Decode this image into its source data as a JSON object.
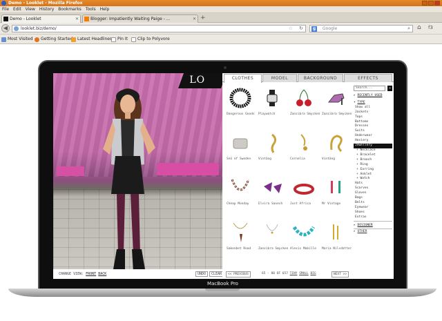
{
  "window": {
    "title": "Demo - Looklet - Mozilla Firefox"
  },
  "menu": [
    "File",
    "Edit",
    "View",
    "History",
    "Bookmarks",
    "Tools",
    "Help"
  ],
  "tabs": [
    {
      "label": "Demo - Looklet",
      "active": true
    },
    {
      "label": "Blogger: Impatiently Waiting Paige - ...",
      "active": false
    }
  ],
  "nav": {
    "url": "looklet.biz/demo/",
    "search_placeholder": "Google"
  },
  "bookmarks": [
    "Most Visited",
    "Getting Started",
    "Latest Headlines",
    "Pin It",
    "Clip to Polyvore"
  ],
  "app": {
    "logo": "LO",
    "panel_tabs": [
      "CLOTHES",
      "MODEL",
      "BACKGROUND",
      "EFFECTS"
    ],
    "items": [
      {
        "label": "Dangerous Goods",
        "icon": "black-beaded-necklace"
      },
      {
        "label": "Playwatch",
        "icon": "watch"
      },
      {
        "label": "Zanzibra Smycken",
        "icon": "cherry-earrings"
      },
      {
        "label": "Zanzibra Smycken",
        "icon": "shoe-brooch"
      },
      {
        "label": "Snö of Sweden",
        "icon": "silver-cuff"
      },
      {
        "label": "Vintäng",
        "icon": "gold-ring"
      },
      {
        "label": "Cornelia",
        "icon": "gold-pendant"
      },
      {
        "label": "Vintäng",
        "icon": "gold-brooch"
      },
      {
        "label": "Cheap Monday",
        "icon": "tribal-necklace"
      },
      {
        "label": "Elvira Saxesh",
        "icon": "purple-earrings"
      },
      {
        "label": "Just Africa",
        "icon": "red-bracelet"
      },
      {
        "label": "Mr Vintage",
        "icon": "drop-earrings"
      },
      {
        "label": "Sakenbet Road",
        "icon": "horn-necklace"
      },
      {
        "label": "Zanzibra Smycken",
        "icon": "thin-chain"
      },
      {
        "label": "Alexis Mabille",
        "icon": "turquoise-necklace"
      },
      {
        "label": "Maria Nilsdotter",
        "icon": "gold-earrings"
      }
    ],
    "change_view": {
      "label": "CHANGE VIEW:",
      "front": "FRONT",
      "back": "BACK"
    },
    "undo": "UNDO",
    "clear": "CLEAR",
    "pager": {
      "prev": "<< PREVIOUS",
      "info": "65 - 80 OF 657",
      "tiny": "TINY",
      "small": "SMALL",
      "big": "BIG",
      "next": "NEXT >>"
    },
    "sidebar": {
      "search_placeholder": "Search...",
      "go": "»",
      "recently_used": "RECENTLY USED",
      "type": "TYPE",
      "categories": [
        "Show all",
        "Jackets",
        "Tops",
        "Bottoms",
        "Dresses",
        "Suits",
        "Underwear",
        "Hosiery",
        "Jewellery",
        "Necklace",
        "Bracelet",
        "Brooch",
        "Ring",
        "Earring",
        "Anklet",
        "Watch",
        "Hats",
        "Scarves",
        "Gloves",
        "Bags",
        "Belts",
        "Eyewear",
        "Shoes",
        "Extras"
      ],
      "designer": "DESIGNER",
      "other": "OTHER"
    },
    "brand": "MacBook Pro"
  },
  "colors": {
    "firefox_orange": "#e0801f",
    "wall_pink": "#c86db0",
    "active_black": "#111111"
  }
}
